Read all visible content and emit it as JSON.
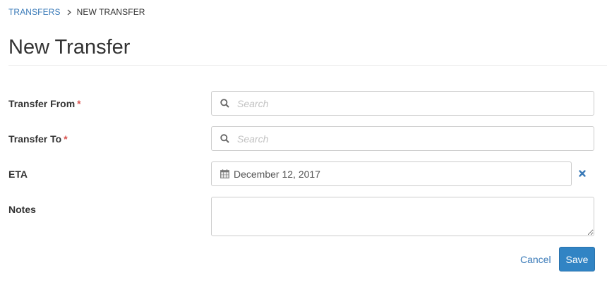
{
  "breadcrumb": {
    "parent": "TRANSFERS",
    "current": "NEW TRANSFER"
  },
  "page": {
    "title": "New Transfer"
  },
  "form": {
    "transfer_from": {
      "label": "Transfer From",
      "required_mark": "*",
      "placeholder": "Search",
      "value": ""
    },
    "transfer_to": {
      "label": "Transfer To",
      "required_mark": "*",
      "placeholder": "Search",
      "value": ""
    },
    "eta": {
      "label": "ETA",
      "value": "December 12, 2017"
    },
    "notes": {
      "label": "Notes",
      "value": ""
    }
  },
  "actions": {
    "cancel_label": "Cancel",
    "save_label": "Save"
  },
  "icons": {
    "search": "search-icon",
    "calendar": "calendar-icon",
    "clear": "close-icon",
    "chevron": "chevron-right-icon"
  },
  "colors": {
    "link": "#3a7ab8",
    "required": "#d9534f",
    "primary_button": "#3184c4",
    "clear_icon": "#3a7ab8"
  }
}
